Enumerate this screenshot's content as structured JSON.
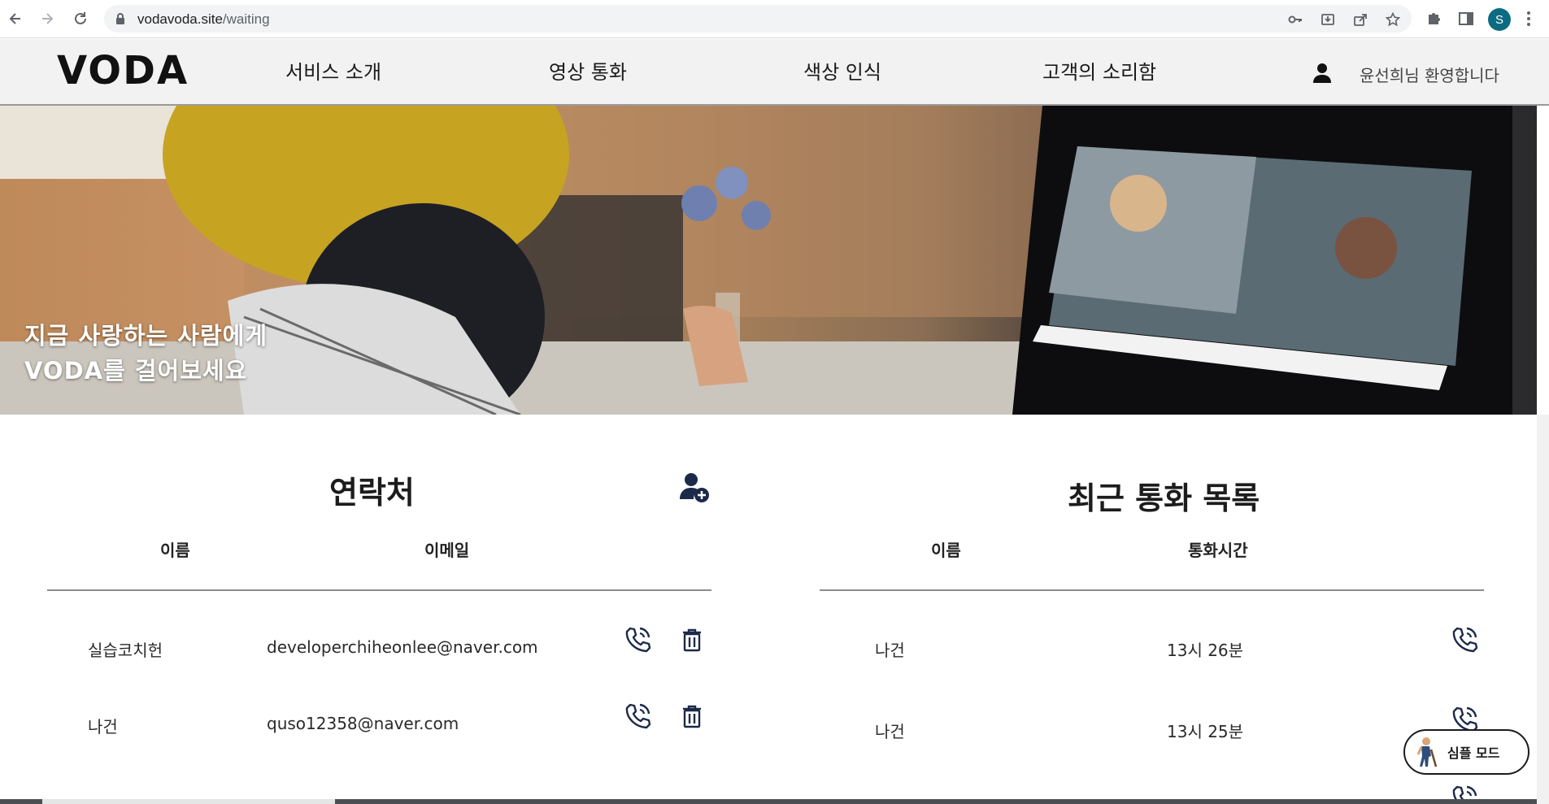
{
  "browser": {
    "url_domain": "vodavoda.site",
    "url_path": "/waiting",
    "profile_initial": "S"
  },
  "header": {
    "logo": "VODA",
    "nav": [
      "서비스 소개",
      "영상 통화",
      "색상 인식",
      "고객의 소리함"
    ],
    "welcome": "윤선희님 환영합니다"
  },
  "hero": {
    "line1": "지금 사랑하는 사람에게",
    "line2": "VODA를 걸어보세요"
  },
  "contacts": {
    "title": "연락처",
    "col_name": "이름",
    "col_email": "이메일",
    "rows": [
      {
        "name": "실습코치헌",
        "email": "developerchiheonlee@naver.com"
      },
      {
        "name": "나건",
        "email": "quso12358@naver.com"
      }
    ]
  },
  "recent": {
    "title": "최근 통화 목록",
    "col_name": "이름",
    "col_time": "통화시간",
    "rows": [
      {
        "name": "나건",
        "time": "13시 26분"
      },
      {
        "name": "나건",
        "time": "13시 25분"
      }
    ]
  },
  "simple_mode": {
    "label": "심플 모드"
  },
  "icons": {
    "add_contact": "add-user-icon",
    "call": "phone-call-icon",
    "delete": "trash-icon",
    "user": "user-icon"
  },
  "colors": {
    "header_bg": "#f2f2f2",
    "icon_navy": "#1c2a4a",
    "profile": "#0b6b80"
  }
}
